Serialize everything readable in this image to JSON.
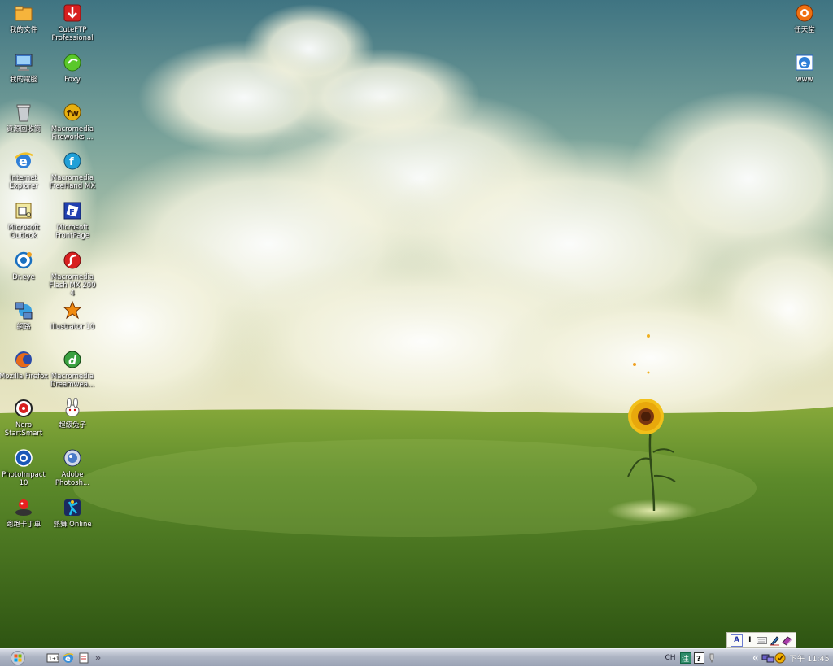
{
  "desktop": {
    "icons_left": [
      {
        "label": "我的文件",
        "icon": "folder-icon"
      },
      {
        "label": "我的電腦",
        "icon": "computer-icon"
      },
      {
        "label": "資源回收筒",
        "icon": "recycle-bin-icon"
      },
      {
        "label": "Internet\nExplorer",
        "icon": "internet-explorer-icon"
      },
      {
        "label": "Microsoft\nOutlook",
        "icon": "outlook-icon"
      },
      {
        "label": "Dr.eye",
        "icon": "dreye-icon"
      },
      {
        "label": "網路",
        "icon": "network-icon"
      },
      {
        "label": "Mozilla Firefox",
        "icon": "firefox-icon"
      },
      {
        "label": "Nero\nStartSmart",
        "icon": "nero-icon"
      },
      {
        "label": "PhotoImpact\n10",
        "icon": "photoimpact-icon"
      },
      {
        "label": "跑跑卡丁車",
        "icon": "kartrider-icon"
      }
    ],
    "icons_col2": [
      {
        "label": "CuteFTP\nProfessional",
        "icon": "cuteftp-icon"
      },
      {
        "label": "Foxy",
        "icon": "foxy-icon"
      },
      {
        "label": "Macromedia\nFireworks ...",
        "icon": "fireworks-icon"
      },
      {
        "label": "Macromedia\nFreeHand MX",
        "icon": "freehand-icon"
      },
      {
        "label": "Microsoft\nFrontPage",
        "icon": "frontpage-icon"
      },
      {
        "label": "Macromedia\nFlash MX 2004",
        "icon": "flash-icon"
      },
      {
        "label": "Illustrator 10",
        "icon": "illustrator-icon"
      },
      {
        "label": "Macromedia\nDreamwea...",
        "icon": "dreamweaver-icon"
      },
      {
        "label": "超級兔子",
        "icon": "super-rabbit-icon"
      },
      {
        "label": "Adobe\nPhotosh...",
        "icon": "photoshop-icon"
      },
      {
        "label": "熱舞 Online",
        "icon": "dance-online-icon"
      }
    ],
    "icons_right": [
      {
        "label": "任天堂",
        "icon": "nintendo-icon"
      },
      {
        "label": "www",
        "icon": "www-shortcut-icon"
      }
    ]
  },
  "language_bar": {
    "items": [
      "A",
      "I",
      "",
      "",
      ""
    ],
    "icons": [
      "ime-mode-icon",
      "ime-width-icon",
      "ime-keyboard-icon",
      "ime-pen-icon",
      "ime-dictionary-icon"
    ]
  },
  "taskbar": {
    "start_icon": "windows-start-icon",
    "quick_launch": [
      "show-desktop-icon",
      "ie-quicklaunch-icon",
      "notepad-icon"
    ],
    "language": "CH",
    "clock": "下午 11:45",
    "tray_icons": [
      "input-method-icon",
      "help-icon",
      "chevron-icon",
      "network-tray-icon",
      "security-tray-icon"
    ]
  },
  "colors": {
    "taskbar_top": "#d9dde6",
    "taskbar_bottom": "#9aa2b4",
    "sky": "#5f8f8f",
    "grass": "#4c7a22"
  }
}
